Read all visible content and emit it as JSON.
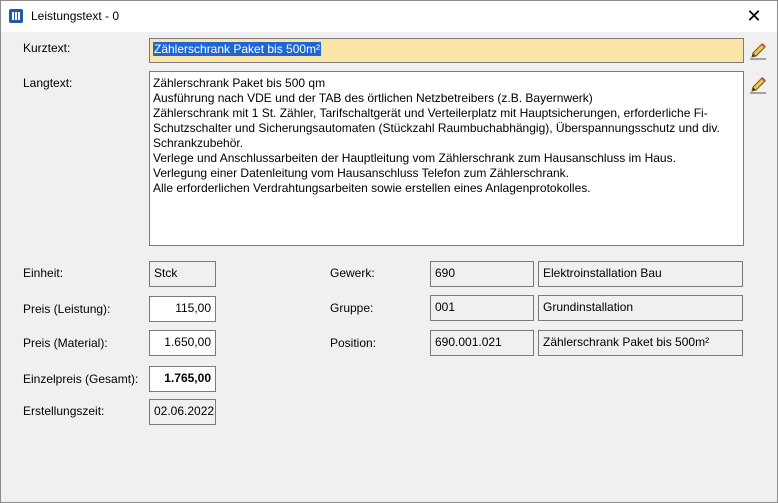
{
  "window": {
    "title": "Leistungstext - 0",
    "close_glyph": "✕"
  },
  "labels": {
    "kurztext": "Kurztext:",
    "langtext": "Langtext:",
    "einheit": "Einheit:",
    "preis_leistung": "Preis (Leistung):",
    "preis_material": "Preis (Material):",
    "einzelpreis": "Einzelpreis (Gesamt):",
    "erstellungszeit": "Erstellungszeit:",
    "gewerk": "Gewerk:",
    "gruppe": "Gruppe:",
    "position": "Position:"
  },
  "fields": {
    "kurztext": "Zählerschrank Paket bis 500m²",
    "langtext_lines": [
      "Zählerschrank Paket bis 500 qm",
      "Ausführung nach VDE und der TAB des örtlichen Netzbetreibers (z.B. Bayernwerk)",
      "Zählerschrank mit  1 St. Zähler, Tarifschaltgerät und  Verteilerplatz mit Hauptsicherungen, erforderliche Fi-",
      "Schutzschalter und Sicherungsautomaten (Stückzahl Raumbuchabhängig), Überspannungsschutz und div.",
      "Schrankzubehör.",
      "Verlege und Anschlussarbeiten der Hauptleitung vom Zählerschrank zum Hausanschluss im Haus.",
      "Verlegung einer Datenleitung vom Hausanschluss Telefon zum Zählerschrank.",
      "Alle erforderlichen Verdrahtungsarbeiten sowie erstellen eines Anlagenprotokolles."
    ],
    "einheit": "Stck",
    "preis_leistung": "115,00",
    "preis_material": "1.650,00",
    "einzelpreis": "1.765,00",
    "erstellungszeit": "02.06.2022",
    "gewerk_code": "690",
    "gewerk_name": "Elektroinstallation Bau",
    "gruppe_code": "001",
    "gruppe_name": "Grundinstallation",
    "position_code": "690.001.021",
    "position_name": "Zählerschrank Paket bis 500m²"
  },
  "icons": {
    "app": "app-icon",
    "edit_kurztext": "pencil-icon",
    "edit_langtext": "pencil-icon",
    "close": "close-icon"
  },
  "colors": {
    "selection": "#1e66d2",
    "kurztext_bg": "#fbe4a8",
    "app_icon": "#1e5aa8"
  }
}
